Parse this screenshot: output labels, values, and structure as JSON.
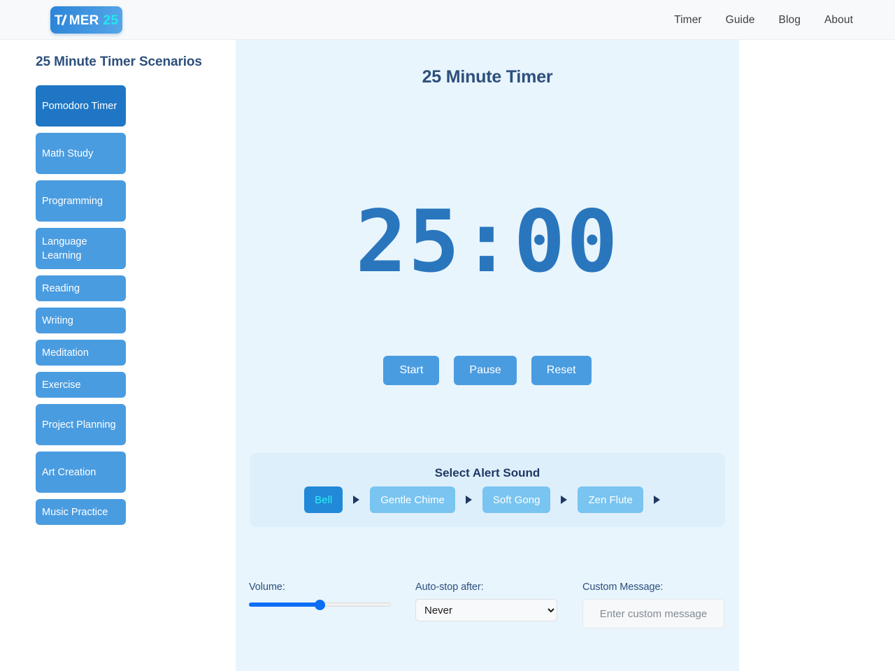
{
  "header": {
    "logo": {
      "word": "MER",
      "prefix": "T",
      "number": "25",
      "icon": "clock-hand-icon"
    },
    "nav": [
      {
        "label": "Timer"
      },
      {
        "label": "Guide"
      },
      {
        "label": "Blog"
      },
      {
        "label": "About"
      }
    ]
  },
  "sidebar": {
    "title": "25 Minute Timer Scenarios",
    "scenarios": [
      {
        "label": "Pomodoro Timer",
        "active": true,
        "lines": 2
      },
      {
        "label": "Math Study",
        "active": false,
        "lines": 1
      },
      {
        "label": "Programming",
        "active": false,
        "lines": 1
      },
      {
        "label": "Language Learning",
        "active": false,
        "lines": 2
      },
      {
        "label": "Reading",
        "active": false,
        "lines": 1
      },
      {
        "label": "Writing",
        "active": false,
        "lines": 1
      },
      {
        "label": "Meditation",
        "active": false,
        "lines": 1
      },
      {
        "label": "Exercise",
        "active": false,
        "lines": 1
      },
      {
        "label": "Project Planning",
        "active": false,
        "lines": 2
      },
      {
        "label": "Art Creation",
        "active": false,
        "lines": 1
      },
      {
        "label": "Music Practice",
        "active": false,
        "lines": 1
      }
    ]
  },
  "main": {
    "heading": "25 Minute Timer",
    "time_display": "25:00",
    "controls": [
      {
        "label": "Start"
      },
      {
        "label": "Pause"
      },
      {
        "label": "Reset"
      }
    ],
    "alert_sound": {
      "title": "Select Alert Sound",
      "options": [
        {
          "label": "Bell",
          "active": true
        },
        {
          "label": "Gentle Chime",
          "active": false
        },
        {
          "label": "Soft Gong",
          "active": false
        },
        {
          "label": "Zen Flute",
          "active": false
        }
      ],
      "preview_icon": "play-icon"
    },
    "settings": {
      "volume": {
        "label": "Volume:",
        "value": 50
      },
      "autostop": {
        "label": "Auto-stop after:",
        "selected": "Never"
      },
      "message": {
        "label": "Custom Message:",
        "value": "",
        "placeholder": "Enter custom message"
      }
    }
  },
  "colors": {
    "accent_blue": "#4a9ce0",
    "accent_blue_active": "#1f76c4",
    "panel_bg": "#e8f5fd",
    "alert_panel_bg": "#deeffc",
    "heading_navy": "#2d4f7c",
    "timer_blue": "#2a76bd",
    "logo_cyan": "#22e8f0",
    "slider_blue": "#0b6ef4"
  }
}
